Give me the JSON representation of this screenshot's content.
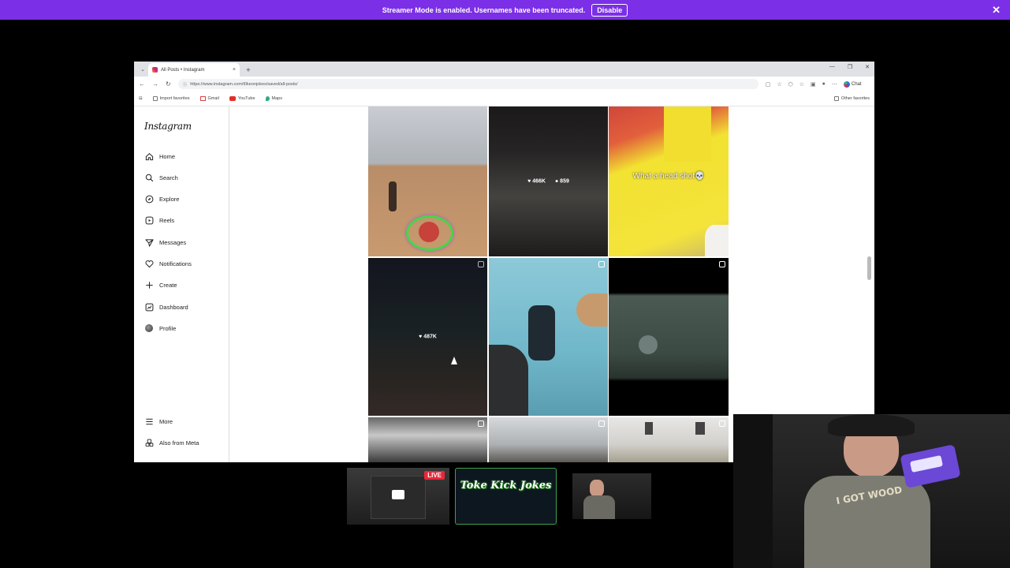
{
  "banner": {
    "message": "Streamer Mode is enabled. Usernames have been truncated.",
    "disable_label": "Disable",
    "close_glyph": "✕"
  },
  "browser": {
    "tab_title": "All Posts • Instagram",
    "tab_close": "×",
    "new_tab": "+",
    "tab_menu": "⌄",
    "window_controls": [
      "—",
      "❐",
      "✕"
    ],
    "nav_glyphs": [
      "←",
      "→",
      "↻"
    ],
    "url": "https://www.instagram.com/t0keonjokes/saved/all-posts/",
    "copilot_label": "Chat",
    "favorites": [
      "Import favorites",
      "Gmail",
      "YouTube",
      "Maps"
    ],
    "other_favorites": "Other favorites"
  },
  "instagram": {
    "logo": "Instagram",
    "nav": [
      {
        "label": "Home",
        "icon": "home-icon"
      },
      {
        "label": "Search",
        "icon": "search-icon"
      },
      {
        "label": "Explore",
        "icon": "compass-icon"
      },
      {
        "label": "Reels",
        "icon": "reels-icon"
      },
      {
        "label": "Messages",
        "icon": "send-icon"
      },
      {
        "label": "Notifications",
        "icon": "heart-icon"
      },
      {
        "label": "Create",
        "icon": "plus-icon"
      },
      {
        "label": "Dashboard",
        "icon": "chart-icon"
      },
      {
        "label": "Profile",
        "icon": "avatar-icon"
      }
    ],
    "more_label": "More",
    "meta_label": "Also from Meta",
    "posts": [
      {
        "likes": "",
        "comments": "",
        "caption": ""
      },
      {
        "likes": "466K",
        "comments": "859",
        "caption": ""
      },
      {
        "likes": "",
        "comments": "",
        "caption": "What a head shot💀"
      },
      {
        "likes": "487K",
        "comments": "",
        "caption": ""
      },
      {
        "likes": "",
        "comments": "",
        "caption": ""
      },
      {
        "likes": "",
        "comments": "",
        "caption": ""
      },
      {
        "likes": "",
        "comments": "",
        "caption": ""
      },
      {
        "likes": "",
        "comments": "",
        "caption": ""
      },
      {
        "likes": "",
        "comments": "",
        "caption": ""
      }
    ]
  },
  "overlay": {
    "live_badge": "LIVE",
    "kick_logo": "Toke Kick Jokes",
    "shirt_text": "I GOT WOOD"
  }
}
